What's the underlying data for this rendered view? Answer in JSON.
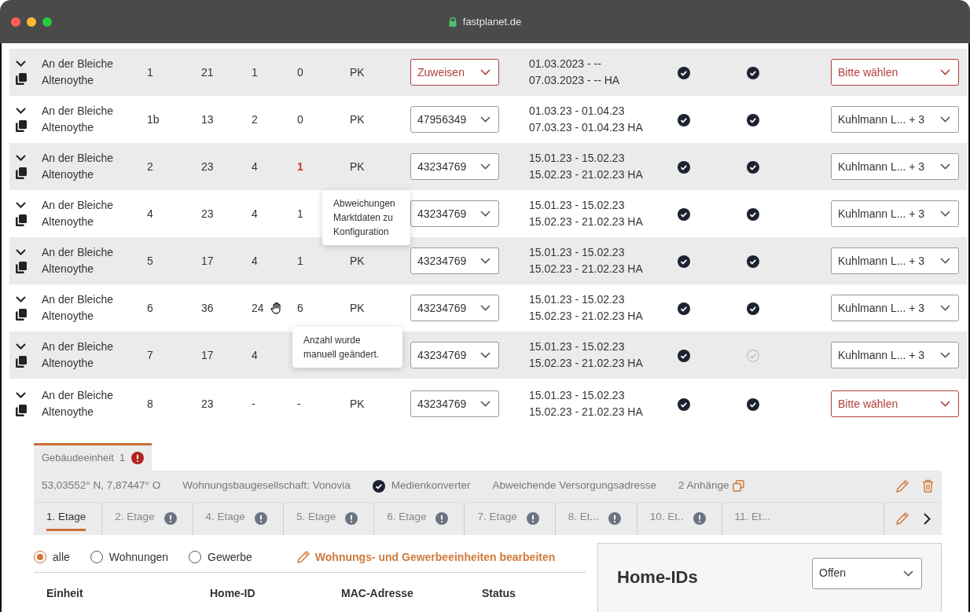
{
  "window": {
    "address": "fastplanet.de"
  },
  "rows": [
    {
      "expanded": false,
      "street": "An der Bleiche",
      "locality": "Altenoythe",
      "column_3": "1",
      "column_4": "21",
      "column_5": "1",
      "manual": false,
      "column_6": "0",
      "alert": false,
      "column_7": "PK",
      "id_select": {
        "value": "Zuweisen",
        "error": true
      },
      "period_1": "01.03.2023 - --",
      "period_2": "07.03.2023 - -- HA",
      "check_1": {
        "done": true
      },
      "check_2": {
        "done": true
      },
      "assignee_select": {
        "value": "Bitte wählen",
        "error": true
      }
    },
    {
      "expanded": false,
      "street": "An der Bleiche",
      "locality": "Altenoythe",
      "column_3": "1b",
      "column_4": "13",
      "column_5": "2",
      "manual": false,
      "column_6": "0",
      "alert": false,
      "column_7": "PK",
      "id_select": {
        "value": "47956349",
        "error": false
      },
      "period_1": "01.03.23 - 01.04.23",
      "period_2": "07.03.23 - 01.04.23 HA",
      "check_1": {
        "done": true
      },
      "check_2": {
        "done": true
      },
      "assignee_select": {
        "value": "Kuhlmann L... + 3",
        "error": false
      }
    },
    {
      "expanded": false,
      "street": "An der Bleiche",
      "locality": "Altenoythe",
      "column_3": "2",
      "column_4": "23",
      "column_5": "4",
      "manual": false,
      "column_6": "1",
      "alert": true,
      "column_7": "PK",
      "id_select": {
        "value": "43234769",
        "error": false
      },
      "period_1": "15.01.23 - 15.02.23",
      "period_2": "15.02.23 - 21.02.23 HA",
      "check_1": {
        "done": true
      },
      "check_2": {
        "done": true
      },
      "assignee_select": {
        "value": "Kuhlmann L... + 3",
        "error": false
      },
      "tooltip": "Abweichungen Marktdaten zu Konfiguration"
    },
    {
      "expanded": false,
      "street": "An der Bleiche",
      "locality": "Altenoythe",
      "column_3": "4",
      "column_4": "23",
      "column_5": "4",
      "manual": false,
      "column_6": "1",
      "alert": false,
      "id_select": {
        "value": "43234769",
        "error": false
      },
      "period_1": "15.01.23 - 15.02.23",
      "period_2": "15.02.23 - 21.02.23 HA",
      "check_1": {
        "done": true
      },
      "check_2": {
        "done": true
      },
      "assignee_select": {
        "value": "Kuhlmann L... + 3",
        "error": false
      }
    },
    {
      "expanded": false,
      "street": "An der Bleiche",
      "locality": "Altenoythe",
      "column_3": "5",
      "column_4": "17",
      "column_5": "4",
      "manual": false,
      "column_6": "1",
      "alert": false,
      "column_7": "PK",
      "id_select": {
        "value": "43234769",
        "error": false
      },
      "period_1": "15.01.23 - 15.02.23",
      "period_2": "15.02.23 - 21.02.23 HA",
      "check_1": {
        "done": true
      },
      "check_2": {
        "done": true
      },
      "assignee_select": {
        "value": "Kuhlmann L... + 3",
        "error": false
      }
    },
    {
      "expanded": false,
      "street": "An der Bleiche",
      "locality": "Altenoythe",
      "column_3": "6",
      "column_4": "36",
      "column_5": "24",
      "manual": true,
      "column_6": "6",
      "alert": false,
      "column_7": "PK",
      "id_select": {
        "value": "43234769",
        "error": false
      },
      "period_1": "15.01.23 - 15.02.23",
      "period_2": "15.02.23 - 21.02.23 HA",
      "check_1": {
        "done": true
      },
      "check_2": {
        "done": true
      },
      "assignee_select": {
        "value": "Kuhlmann L... + 3",
        "error": false
      },
      "tooltip": "Anzahl wurde manuell geändert."
    },
    {
      "expanded": false,
      "street": "An der Bleiche",
      "locality": "Altenoythe",
      "column_3": "7",
      "column_4": "17",
      "column_5": "4",
      "manual": false,
      "id_select": {
        "value": "43234769",
        "error": false
      },
      "period_1": "15.01.23 - 15.02.23",
      "period_2": "15.02.23 - 21.02.23 HA",
      "check_1": {
        "done": true
      },
      "check_2": {
        "done": false
      },
      "assignee_select": {
        "value": "Kuhlmann L... + 3",
        "error": false
      }
    },
    {
      "expanded": false,
      "street": "An der Bleiche",
      "locality": "Altenoythe",
      "column_3": "8",
      "column_4": "23",
      "column_5": "-",
      "manual": false,
      "column_6": "-",
      "alert": false,
      "column_7": "PK",
      "id_select": {
        "value": "43234769",
        "error": false
      },
      "period_1": "15.01.23 - 15.02.23",
      "period_2": "15.02.23 - 21.02.23 HA",
      "check_1": {
        "done": true
      },
      "check_2": {
        "done": true
      },
      "assignee_select": {
        "value": "Bitte wählen",
        "error": true
      }
    }
  ],
  "building_tabs": [
    {
      "label": "Gebäudeeinheit  1",
      "selected": true,
      "alert": true
    }
  ],
  "info": {
    "coordinates": "53,03552° N, 7,87447° O",
    "company": "Wohnungsbaugesellschaft: Vonovia",
    "media_converter": {
      "label": "Medienkonverter",
      "checked": true
    },
    "supply_address": "Abweichende Versorgungsadresse",
    "attachments": "2 Anhänge"
  },
  "floor_tabs": [
    {
      "label": "1. Etage",
      "selected": true,
      "alert": false
    },
    {
      "label": "2. Etage",
      "selected": false,
      "alert": true
    },
    {
      "label": "4. Etage",
      "selected": false,
      "alert": true
    },
    {
      "label": "5. Etage",
      "selected": false,
      "alert": true
    },
    {
      "label": "6. Etage",
      "selected": false,
      "alert": true
    },
    {
      "label": "7. Etage",
      "selected": false,
      "alert": true
    },
    {
      "label": "8. Et...",
      "selected": false,
      "alert": true
    },
    {
      "label": "10. Et..",
      "selected": false,
      "alert": true
    },
    {
      "label": "11. Et...",
      "selected": false,
      "alert": false
    }
  ],
  "filters": [
    {
      "label": "alle",
      "selected": true
    },
    {
      "label": "Wohnungen",
      "selected": false
    },
    {
      "label": "Gewerbe",
      "selected": false
    }
  ],
  "edit_link": "Wohnungs- und Gewerbeeinheiten bearbeiten",
  "table": {
    "columns": [
      "Einheit",
      "Home-ID",
      "MAC-Adresse",
      "Status"
    ]
  },
  "panel": {
    "title": "Home-IDs",
    "status_select": {
      "value": "Offen"
    }
  }
}
